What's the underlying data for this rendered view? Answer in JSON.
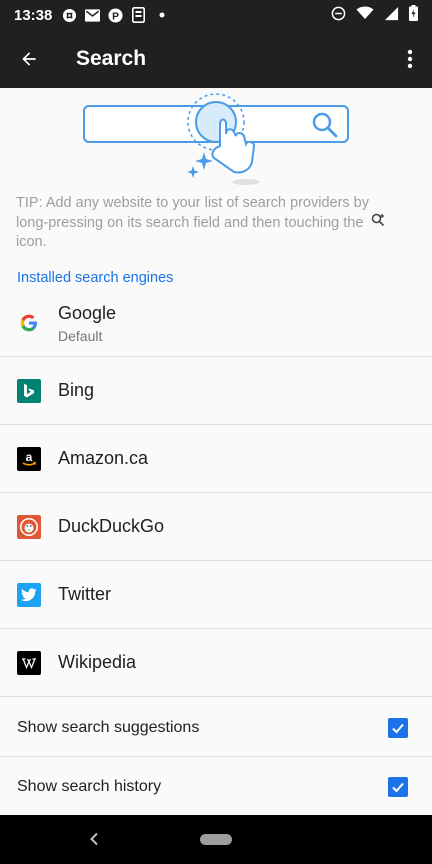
{
  "status_bar": {
    "time": "13:38",
    "icons": [
      "slack-icon",
      "gmail-icon",
      "parking-icon",
      "sim-icon",
      "dot-icon"
    ],
    "right_icons": [
      "do-not-disturb-icon",
      "wifi-icon",
      "signal-icon",
      "battery-icon"
    ]
  },
  "app_bar": {
    "title": "Search",
    "back_icon": "arrow-back-icon",
    "menu_icon": "more-vert-icon"
  },
  "tip": {
    "text": "TIP: Add any website to your list of search providers by long-pressing on its search field and then touching the",
    "text_end": "icon.",
    "icon": "search-add-icon"
  },
  "section": {
    "title": "Installed search engines"
  },
  "engines": [
    {
      "name": "Google",
      "subtitle": "Default",
      "icon": "google-icon"
    },
    {
      "name": "Bing",
      "subtitle": "",
      "icon": "bing-icon"
    },
    {
      "name": "Amazon.ca",
      "subtitle": "",
      "icon": "amazon-icon"
    },
    {
      "name": "DuckDuckGo",
      "subtitle": "",
      "icon": "duckduckgo-icon"
    },
    {
      "name": "Twitter",
      "subtitle": "",
      "icon": "twitter-icon"
    },
    {
      "name": "Wikipedia",
      "subtitle": "",
      "icon": "wikipedia-icon"
    }
  ],
  "settings": {
    "suggestions_label": "Show search suggestions",
    "suggestions_checked": true,
    "history_label": "Show search history",
    "history_checked": true
  },
  "colors": {
    "app_bar": "#202020",
    "accent": "#1a73e8",
    "bing": "#008373",
    "amazon": "#000000",
    "duckduckgo": "#de5833",
    "twitter": "#1da1f2",
    "wikipedia": "#000000"
  }
}
